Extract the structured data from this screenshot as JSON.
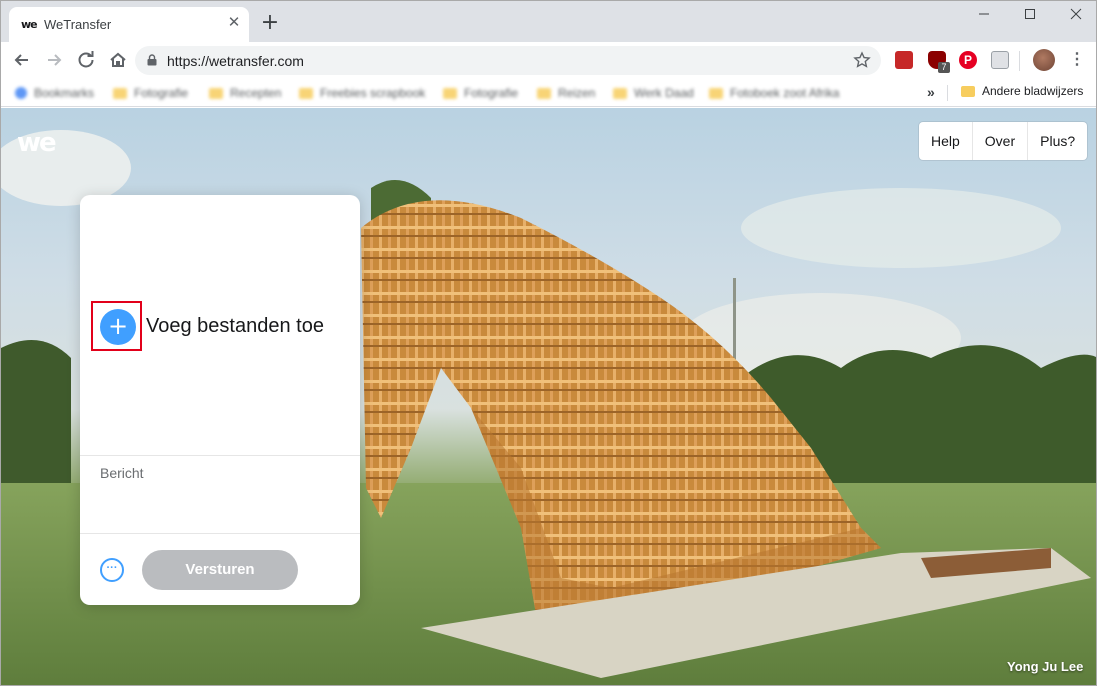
{
  "browser": {
    "tab_title": "WeTransfer",
    "tab_favicon_text": "we",
    "url": "https://wetransfer.com",
    "bookmarks": [
      {
        "label": "Bookmarks",
        "icon": "apps-icon"
      },
      {
        "label": "Fotografie",
        "icon": "folder-icon"
      },
      {
        "label": "Recepten",
        "icon": "folder-icon"
      },
      {
        "label": "Freebies scrapbook",
        "icon": "folder-icon"
      },
      {
        "label": "Fotografie",
        "icon": "folder-icon"
      },
      {
        "label": "Reizen",
        "icon": "folder-icon"
      },
      {
        "label": "Werk Daad",
        "icon": "folder-icon"
      },
      {
        "label": "Fotoboek zoot Afrika",
        "icon": "folder-icon"
      }
    ],
    "bookmarks_more": "»",
    "other_bookmarks": "Andere bladwijzers",
    "extension_badge": "7"
  },
  "page": {
    "logo": "we",
    "nav": [
      "Help",
      "Over",
      "Plus?"
    ],
    "uploader": {
      "add_files_label": "Voeg bestanden toe",
      "add_icon": "+",
      "message_placeholder": "Bericht",
      "options_icon": "···",
      "send_label": "Versturen"
    },
    "photo_credit": "Yong Ju Lee"
  },
  "colors": {
    "accent": "#409fff",
    "highlight": "#e2001a",
    "send_disabled": "#babcbf"
  }
}
